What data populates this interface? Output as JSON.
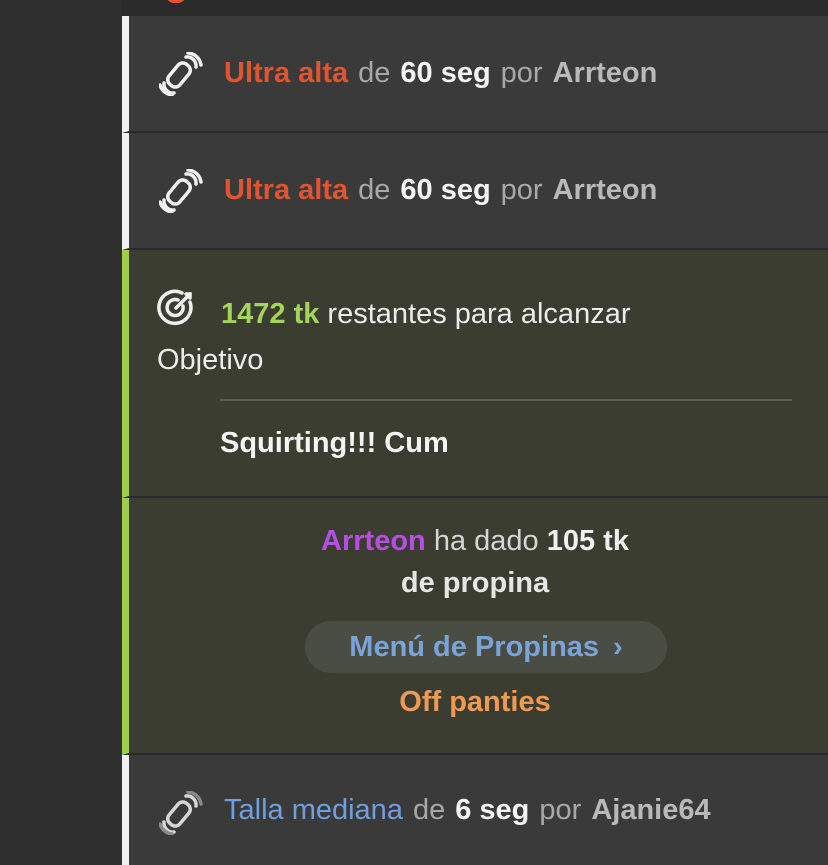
{
  "feed": {
    "vibe_events": [
      {
        "level": "Ultra alta",
        "connector_de": "de",
        "duration": "60 seg",
        "connector_por": "por",
        "user": "Arrteon"
      },
      {
        "level": "Ultra alta",
        "connector_de": "de",
        "duration": "60 seg",
        "connector_por": "por",
        "user": "Arrteon"
      }
    ],
    "goal": {
      "tokens": "1472 tk",
      "text": "restantes para alcanzar Objetivo",
      "goal_name": "Squirting!!! Cum"
    },
    "tip": {
      "user": "Arrteon",
      "action": "ha dado",
      "amount": "105 tk",
      "suffix": "de propina",
      "menu_label": "Menú de Propinas",
      "menu_chevron": "›",
      "item": "Off panties"
    },
    "last_event": {
      "level": "Talla mediana",
      "connector_de": "de",
      "duration": "6 seg",
      "connector_por": "por",
      "user": "Ajanie64"
    }
  },
  "icons": [
    "vibration-wave-icon",
    "goal-target-icon",
    "chevron-right-icon"
  ],
  "colors": {
    "ultra_high": "#e2532f",
    "medium": "#6f9fe3",
    "goal_green": "#a4d45a",
    "tipper_purple": "#b44fe0",
    "menu_item_orange": "#ee9a55",
    "menu_link_blue": "#7aa3d8"
  }
}
